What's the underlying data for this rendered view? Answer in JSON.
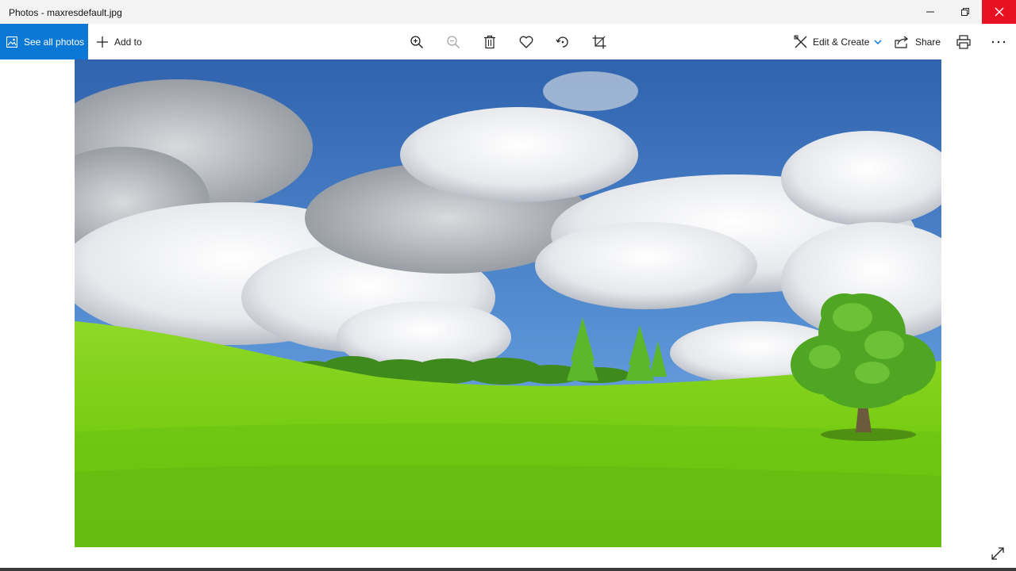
{
  "window": {
    "title": "Photos - maxresdefault.jpg",
    "close_color": "#e81123"
  },
  "toolbar": {
    "see_all_label": "See all photos",
    "add_to_label": "Add to",
    "edit_create_label": "Edit & Create",
    "share_label": "Share",
    "accent": "#0a78d4",
    "tools": [
      "zoom-in-icon",
      "zoom-out-icon",
      "delete-icon",
      "heart-icon",
      "rotate-icon",
      "crop-icon"
    ]
  },
  "photo": {
    "subject": "landscape",
    "sky_color": "#3f78c4",
    "grass_color": "#7fd11a"
  }
}
